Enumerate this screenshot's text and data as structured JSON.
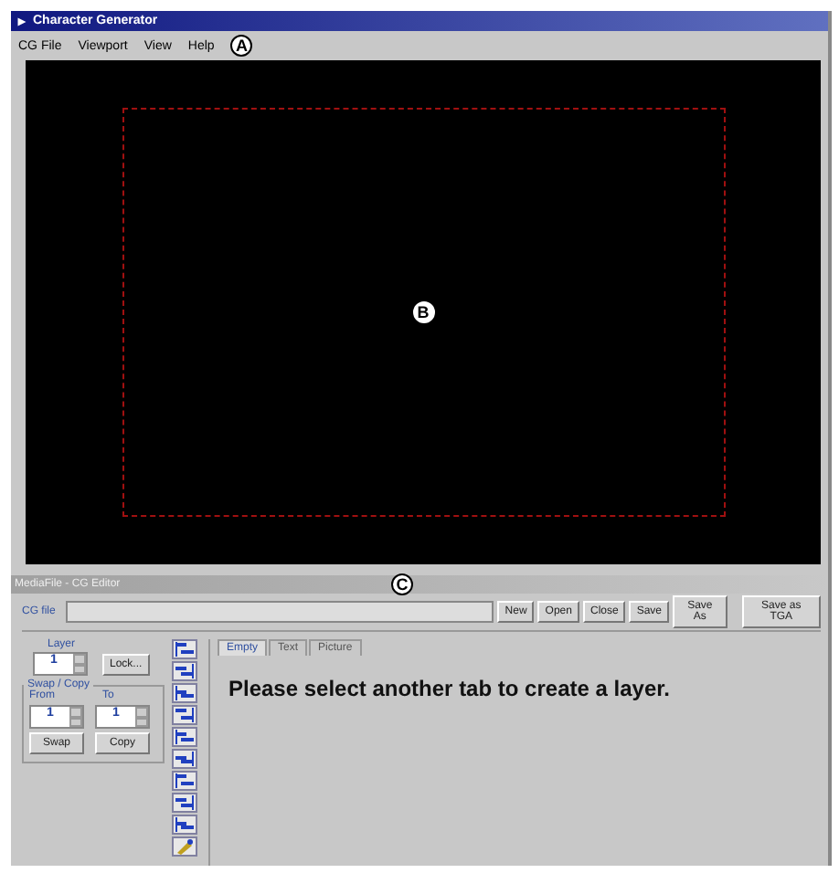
{
  "window": {
    "title": "Character Generator"
  },
  "menu": [
    "CG File",
    "Viewport",
    "View",
    "Help"
  ],
  "callouts": [
    {
      "label": "A",
      "kind": "menu"
    },
    {
      "label": "B",
      "kind": "canvas"
    },
    {
      "label": "C",
      "kind": "panel"
    }
  ],
  "editor": {
    "title": "MediaFile - CG Editor",
    "file_label": "CG file",
    "buttons": [
      "New",
      "Open",
      "Close",
      "Save",
      "Save As",
      "Save as TGA"
    ],
    "layer": {
      "label": "Layer",
      "value": "1",
      "lock": "Lock..."
    },
    "swap": {
      "title": "Swap / Copy",
      "from_label": "From",
      "to_label": "To",
      "from": "1",
      "to": "1",
      "buttons": [
        "Swap",
        "Copy"
      ]
    },
    "tabs": [
      {
        "label": "Empty",
        "selected": true
      },
      {
        "label": "Text",
        "selected": false
      },
      {
        "label": "Picture",
        "selected": false
      }
    ],
    "message": "Please select another tab to create a layer."
  }
}
